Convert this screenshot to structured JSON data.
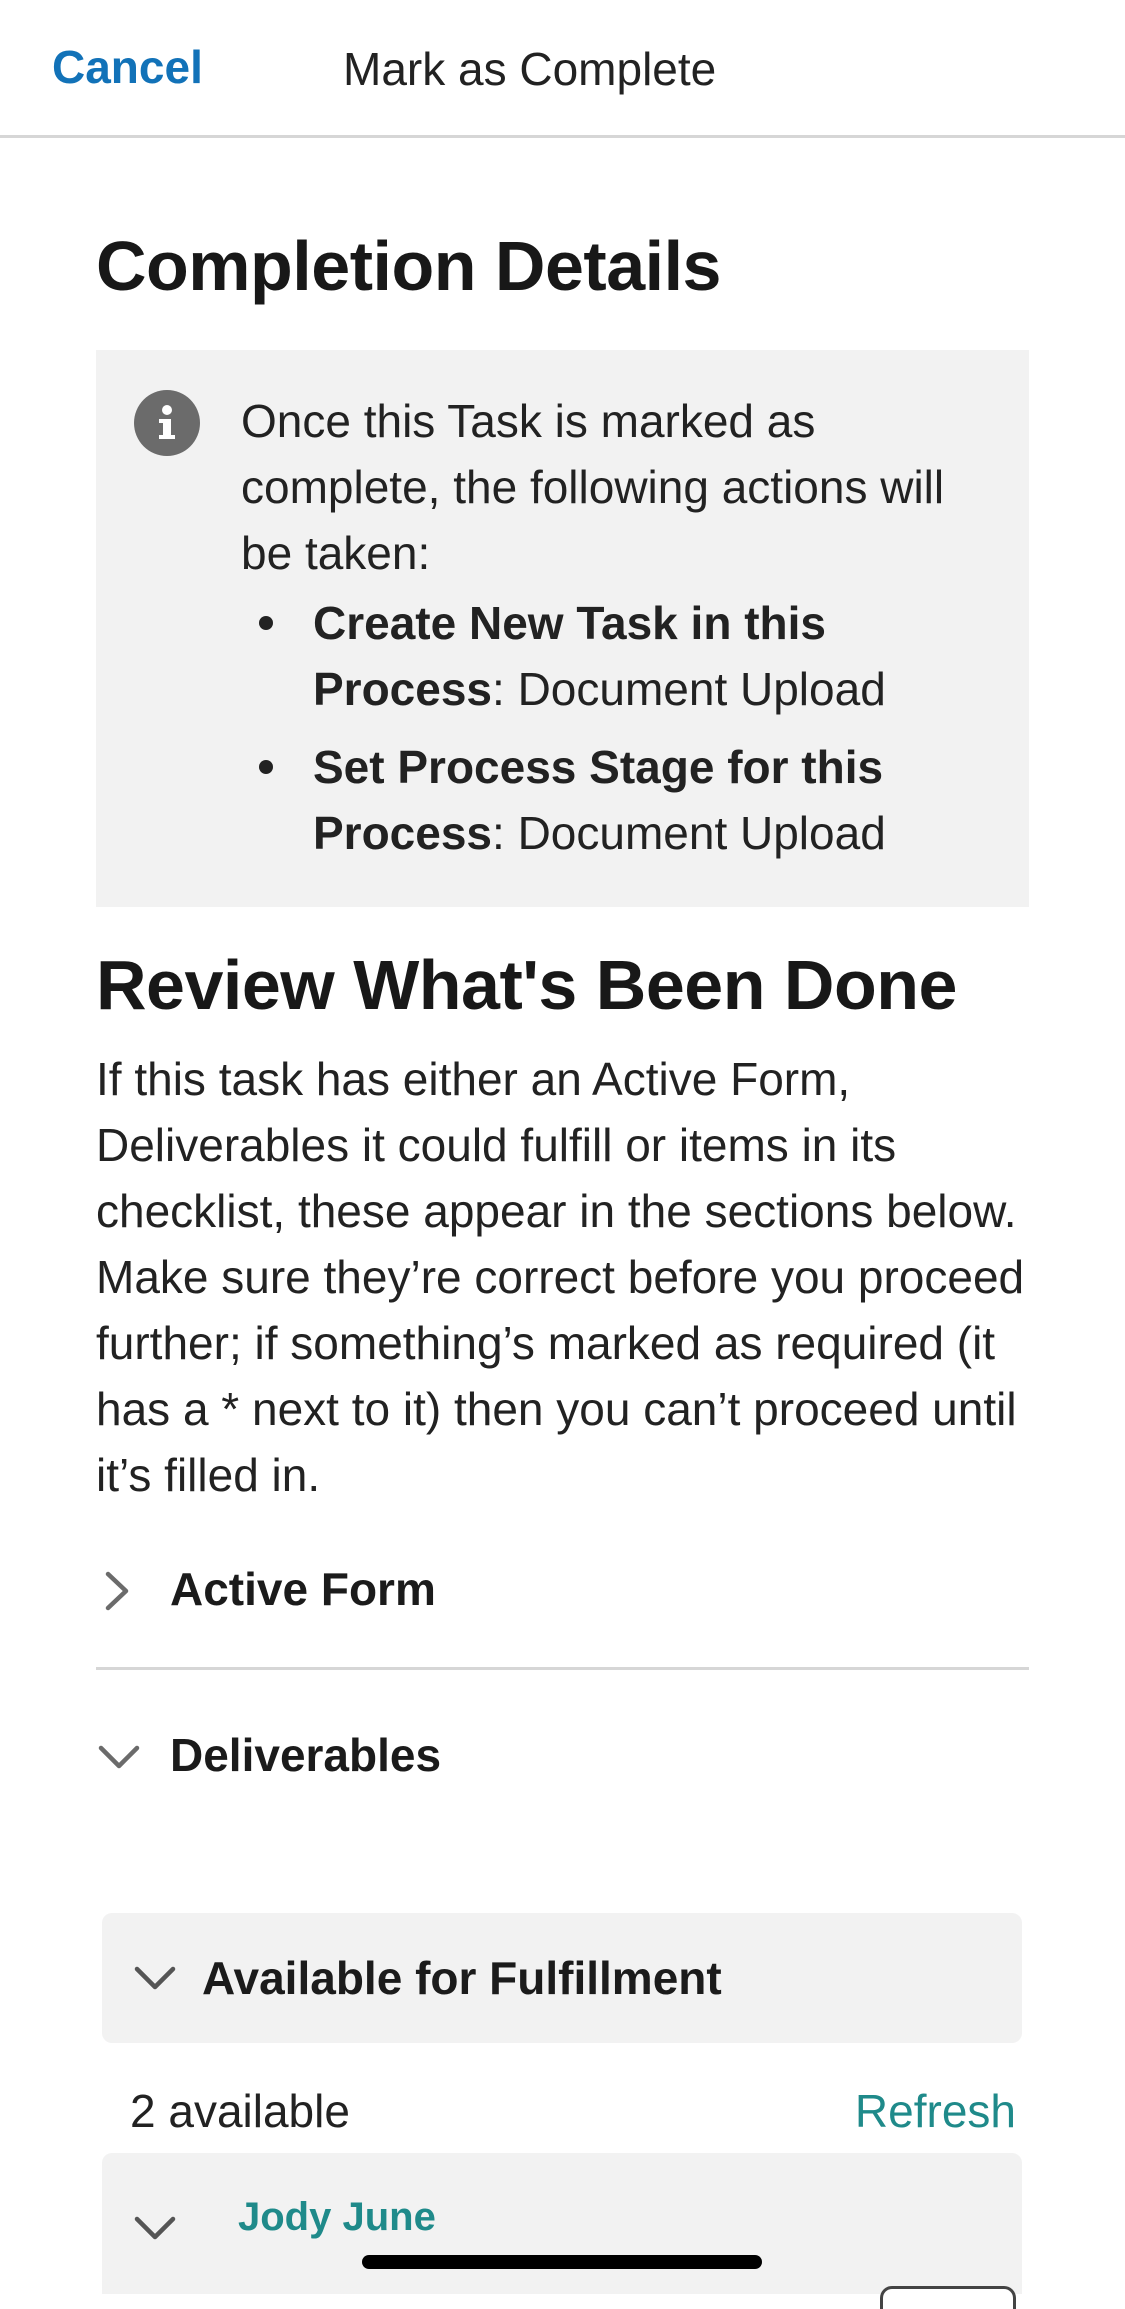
{
  "header": {
    "cancel_label": "Cancel",
    "title": "Mark as Complete"
  },
  "completion": {
    "heading": "Completion Details",
    "info_icon": "info-icon",
    "intro": "Once this Task is marked as complete, the following actions will be taken:",
    "actions": [
      {
        "label": "Create New Task in this Process",
        "value": ": Document Upload"
      },
      {
        "label": "Set Process Stage for this Process",
        "value": ": Document Upload"
      }
    ]
  },
  "review": {
    "heading": "Review What's Been Done",
    "paragraph": "If this task has either an Active Form, Deliverables it could fulfill or items in its checklist, these appear in the sections below. Make sure they’re correct before you proceed further; if something’s marked as required (it has a * next to it) then you can’t proceed until it’s filled in."
  },
  "sections": {
    "active_form_label": "Active Form",
    "deliverables_label": "Deliverables"
  },
  "fulfillment": {
    "panel_label": "Available for Fulfillment",
    "count_text": "2 available",
    "refresh_label": "Refresh",
    "items": [
      {
        "name": "Jody June"
      }
    ]
  },
  "colors": {
    "accent_blue": "#1272b8",
    "accent_teal": "#1f8a8a",
    "panel_bg": "#f2f2f2",
    "divider": "#d6d6d6"
  }
}
